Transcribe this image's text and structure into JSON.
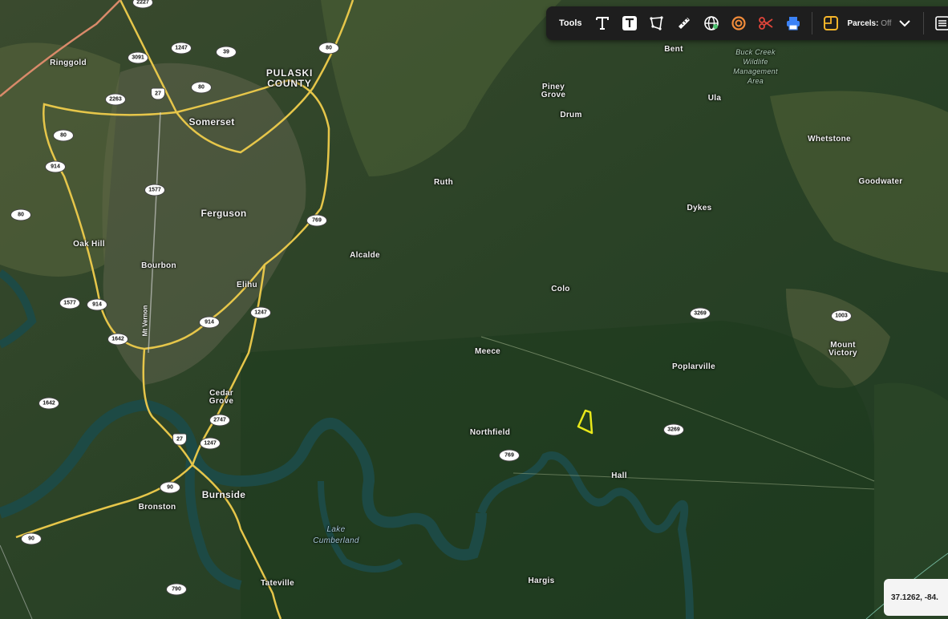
{
  "toolbar": {
    "tools_label": "Tools",
    "icons": [
      "text-icon",
      "text-box-icon",
      "polygon-icon",
      "ruler-icon",
      "globe-icon",
      "circle-icon",
      "scissors-icon",
      "print-icon",
      "parcels-icon",
      "chevron-down-icon",
      "menu-icon"
    ],
    "parcels_label": "Parcels:",
    "parcels_state": "Off"
  },
  "coordinates": "37.1262, -84.",
  "places": {
    "ringgold": "Ringgold",
    "pulaski_county_1": "PULASKI",
    "pulaski_county_2": "COUNTY",
    "somerset": "Somerset",
    "ferguson": "Ferguson",
    "oak_hill": "Oak Hill",
    "bourbon": "Bourbon",
    "elihu": "Elihu",
    "cedar_grove_1": "Cedar",
    "cedar_grove_2": "Grove",
    "burnside": "Burnside",
    "bronston": "Bronston",
    "lake_cumberland_1": "Lake",
    "lake_cumberland_2": "Cumberland",
    "tateville": "Tateville",
    "bent": "Bent",
    "buck_creek_1": "Buck Creek",
    "buck_creek_2": "Wildlife",
    "buck_creek_3": "Management",
    "buck_creek_4": "Area",
    "piney_grove_1": "Piney",
    "piney_grove_2": "Grove",
    "drum": "Drum",
    "ula": "Ula",
    "whetstone": "Whetstone",
    "goodwater": "Goodwater",
    "ruth": "Ruth",
    "dykes": "Dykes",
    "alcalde": "Alcalde",
    "colo": "Colo",
    "meece": "Meece",
    "poplarville": "Poplarville",
    "mount_victory_1": "Mount",
    "mount_victory_2": "Victory",
    "northfield": "Northfield",
    "hall": "Hall",
    "hargis": "Hargis"
  },
  "road_labels": {
    "r2227": "2227",
    "r3091": "3091",
    "r1247a": "1247",
    "r39": "39",
    "r80a": "80",
    "r27a": "27",
    "r80b": "80",
    "r2263": "2263",
    "r80c": "80",
    "r914a": "914",
    "r1577a": "1577",
    "r80d": "80",
    "r769a": "769",
    "r1577b": "1577",
    "r914b": "914",
    "r914c": "914",
    "r1247b": "1247",
    "r1642a": "1642",
    "r1642b": "1642",
    "r27b": "27",
    "r2747": "2747",
    "r1247c": "1247",
    "r90a": "90",
    "r90b": "90",
    "r790": "790",
    "r3269a": "3269",
    "r1003": "1003",
    "r3269b": "3269",
    "r769b": "769"
  },
  "us1401": "Mt Vernon",
  "colors": {
    "toolbar_bg": "#1e1e1e",
    "highway": "#e6c64a",
    "us_route": "#d98a6a",
    "water": "#1d4a45",
    "parcel_outline": "#e8e81a",
    "scissors": "#e0453a",
    "print": "#3b82f6",
    "circle": "#f28c3a",
    "parcels_icon": "#f5b52a"
  }
}
